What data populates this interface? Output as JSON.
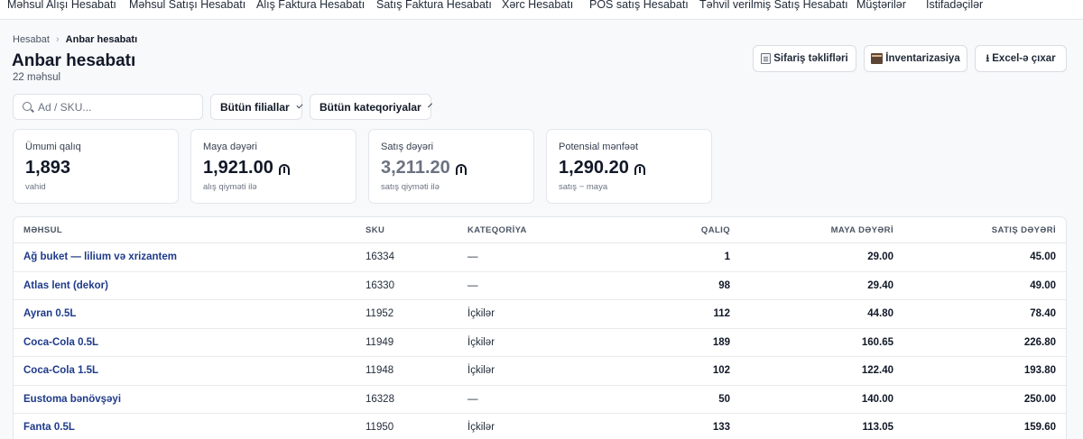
{
  "topnav": {
    "items": [
      "Məhsul Alışı Hesabatı",
      "Məhsul Satışı Hesabatı",
      "Alış Faktura Hesabatı",
      "Satış Faktura Hesabatı",
      "Xərc Hesabatı",
      "POS satış Hesabatı",
      "Təhvil verilmiş Satış Hesabatı",
      "Müştərilər",
      "İstifadəçilər"
    ]
  },
  "breadcrumb": {
    "parent": "Hesabat",
    "separator": "›",
    "current": "Anbar hesabatı"
  },
  "page": {
    "title": "Anbar hesabatı",
    "subtitle": "22 məhsul"
  },
  "actions": {
    "orders": "Sifariş təklifləri",
    "inventory": "İnventarizasiya",
    "export_icon": "⭳",
    "export": "Excel-ə çıxar"
  },
  "filters": {
    "search_placeholder": "Ad / SKU...",
    "search_value": "",
    "branch": "Bütün filiallar",
    "category": "Bütün kateqoriyalar"
  },
  "stats": [
    {
      "label": "Ümumi qalıq",
      "value": "1,893",
      "sub": "vahid",
      "has_eye": false
    },
    {
      "label": "Maya dəyəri",
      "value": "1,921.00",
      "sub": "alış qiyməti ilə",
      "has_eye": true
    },
    {
      "label": "Satış dəyəri",
      "value": "3,211.20",
      "sub": "satış qiyməti ilə",
      "has_eye": true
    },
    {
      "label": "Potensial mənfəət",
      "value": "1,290.20",
      "sub": "satış − maya",
      "has_eye": true
    }
  ],
  "table": {
    "headers": {
      "product": "MƏHSUL",
      "sku": "SKU",
      "category": "KATEQORİYA",
      "stock": "QALIQ",
      "cost": "MAYA DƏYƏRİ",
      "sale": "SATIŞ DƏYƏRİ"
    },
    "rows": [
      {
        "product": "Ağ buket — lilium və xrizantem",
        "sku": "16334",
        "category": "—",
        "stock": "1",
        "cost": "29.00",
        "sale": "45.00"
      },
      {
        "product": "Atlas lent (dekor)",
        "sku": "16330",
        "category": "—",
        "stock": "98",
        "cost": "29.40",
        "sale": "49.00"
      },
      {
        "product": "Ayran 0.5L",
        "sku": "11952",
        "category": "İçkilər",
        "stock": "112",
        "cost": "44.80",
        "sale": "78.40"
      },
      {
        "product": "Coca-Cola 0.5L",
        "sku": "11949",
        "category": "İçkilər",
        "stock": "189",
        "cost": "160.65",
        "sale": "226.80"
      },
      {
        "product": "Coca-Cola 1.5L",
        "sku": "11948",
        "category": "İçkilər",
        "stock": "102",
        "cost": "122.40",
        "sale": "193.80"
      },
      {
        "product": "Eustoma bənövşəyi",
        "sku": "16328",
        "category": "—",
        "stock": "50",
        "cost": "140.00",
        "sale": "250.00"
      },
      {
        "product": "Fanta 0.5L",
        "sku": "11950",
        "category": "İçkilər",
        "stock": "133",
        "cost": "113.05",
        "sale": "159.60"
      }
    ]
  },
  "colors": {
    "link": "#1e3a8a",
    "muted": "#6b7280",
    "border": "#e3e6ea"
  }
}
